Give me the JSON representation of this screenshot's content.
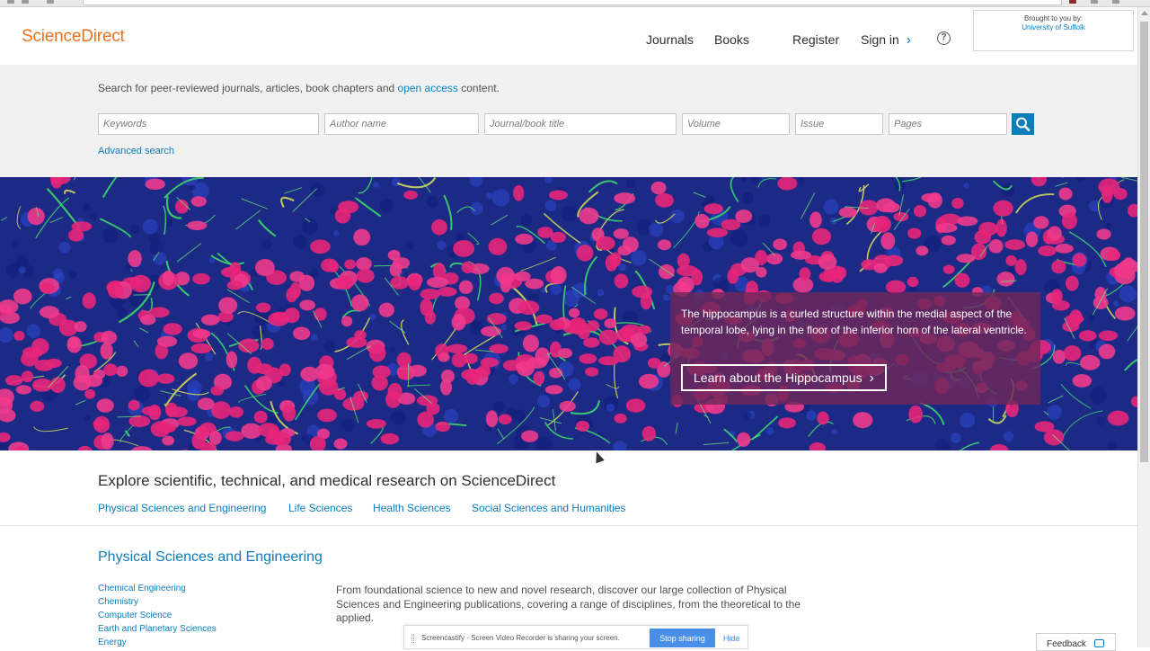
{
  "header": {
    "logo": "ScienceDirect",
    "nav": {
      "journals": "Journals",
      "books": "Books",
      "register": "Register",
      "sign_in": "Sign in",
      "sign_in_chevron": "›",
      "help_glyph": "?"
    },
    "institution": {
      "label": "Brought to you by:",
      "name": "University of Suffolk"
    }
  },
  "search": {
    "intro_prefix": "Search for peer-reviewed journals, articles, book chapters and ",
    "intro_link": "open access",
    "intro_suffix": " content.",
    "fields": {
      "keywords": "Keywords",
      "author": "Author name",
      "journal": "Journal/book title",
      "volume": "Volume",
      "issue": "Issue",
      "pages": "Pages"
    },
    "advanced": "Advanced search"
  },
  "hero": {
    "text": "The hippocampus is a curled structure within the medial aspect of the temporal lobe, lying in the floor of the inferior horn of the lateral ventricle.",
    "button": "Learn about the Hippocampus",
    "button_chevron": "›"
  },
  "explore": {
    "title": "Explore scientific, technical, and medical research on ScienceDirect",
    "links": [
      "Physical Sciences and Engineering",
      "Life Sciences",
      "Health Sciences",
      "Social Sciences and Humanities"
    ]
  },
  "section": {
    "title": "Physical Sciences and Engineering",
    "subjects": [
      "Chemical Engineering",
      "Chemistry",
      "Computer Science",
      "Earth and Planetary Sciences",
      "Energy"
    ],
    "description": "From foundational science to new and novel research, discover our large collection of Physical Sciences and Engineering publications, covering a range of disciplines, from the theoretical to the applied."
  },
  "share_bar": {
    "text": "Screencastify - Screen Video Recorder is sharing your screen.",
    "stop": "Stop sharing",
    "hide": "Hide"
  },
  "feedback": "Feedback",
  "colors": {
    "brand_orange": "#e9711c",
    "link_blue": "#0c7dbb",
    "hero_overlay": "#6e285a"
  }
}
